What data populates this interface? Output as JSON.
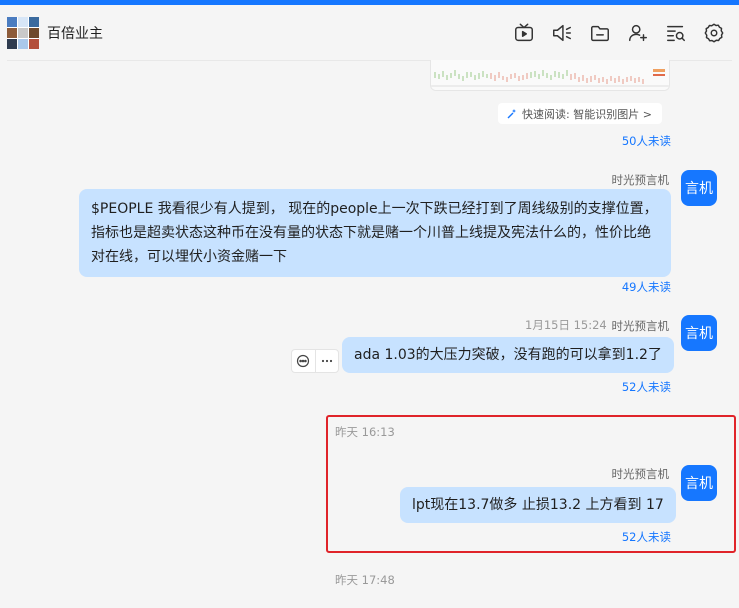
{
  "header": {
    "title": "百倍业主",
    "avatar_tiles": [
      "#4a7cc0",
      "#d7e6f7",
      "#3a6a9e",
      "#8c5b3a",
      "#c9c9c9",
      "#6f4a2c",
      "#2f3b4f",
      "#aac8ea",
      "#b34f3a"
    ],
    "icons": [
      "tv-icon",
      "speaker-icon",
      "folder-icon",
      "add-user-icon",
      "search-list-icon",
      "settings-icon"
    ]
  },
  "top_message": {
    "quick_read_label": "快速阅读: 智能识别图片 >",
    "unread": "50人未读"
  },
  "messages": [
    {
      "sender": "时光预言机",
      "avatar": "言机",
      "time": "",
      "text": "$PEOPLE  我看很少有人提到， 现在的people上一次下跌已经打到了周线级别的支撑位置，指标也是超卖状态这种币在没有量的状态下就是赌一个川普上线提及宪法什么的，性价比绝对在线，可以埋伏小资金赌一下",
      "unread": "49人未读"
    },
    {
      "sender": "时光预言机",
      "avatar": "言机",
      "time": "1月15日 15:24",
      "text": "ada  1.03的大压力突破，没有跑的可以拿到1.2了",
      "unread": "52人未读"
    },
    {
      "sender": "时光预言机",
      "avatar": "言机",
      "time": "昨天 16:13",
      "text": "lpt现在13.7做多 止损13.2 上方看到 17",
      "unread": "52人未读"
    }
  ],
  "bottom_time": "昨天 17:48",
  "colors": {
    "accent": "#1677ff",
    "bubble": "#c7e2ff",
    "highlight": "#e0242a"
  }
}
